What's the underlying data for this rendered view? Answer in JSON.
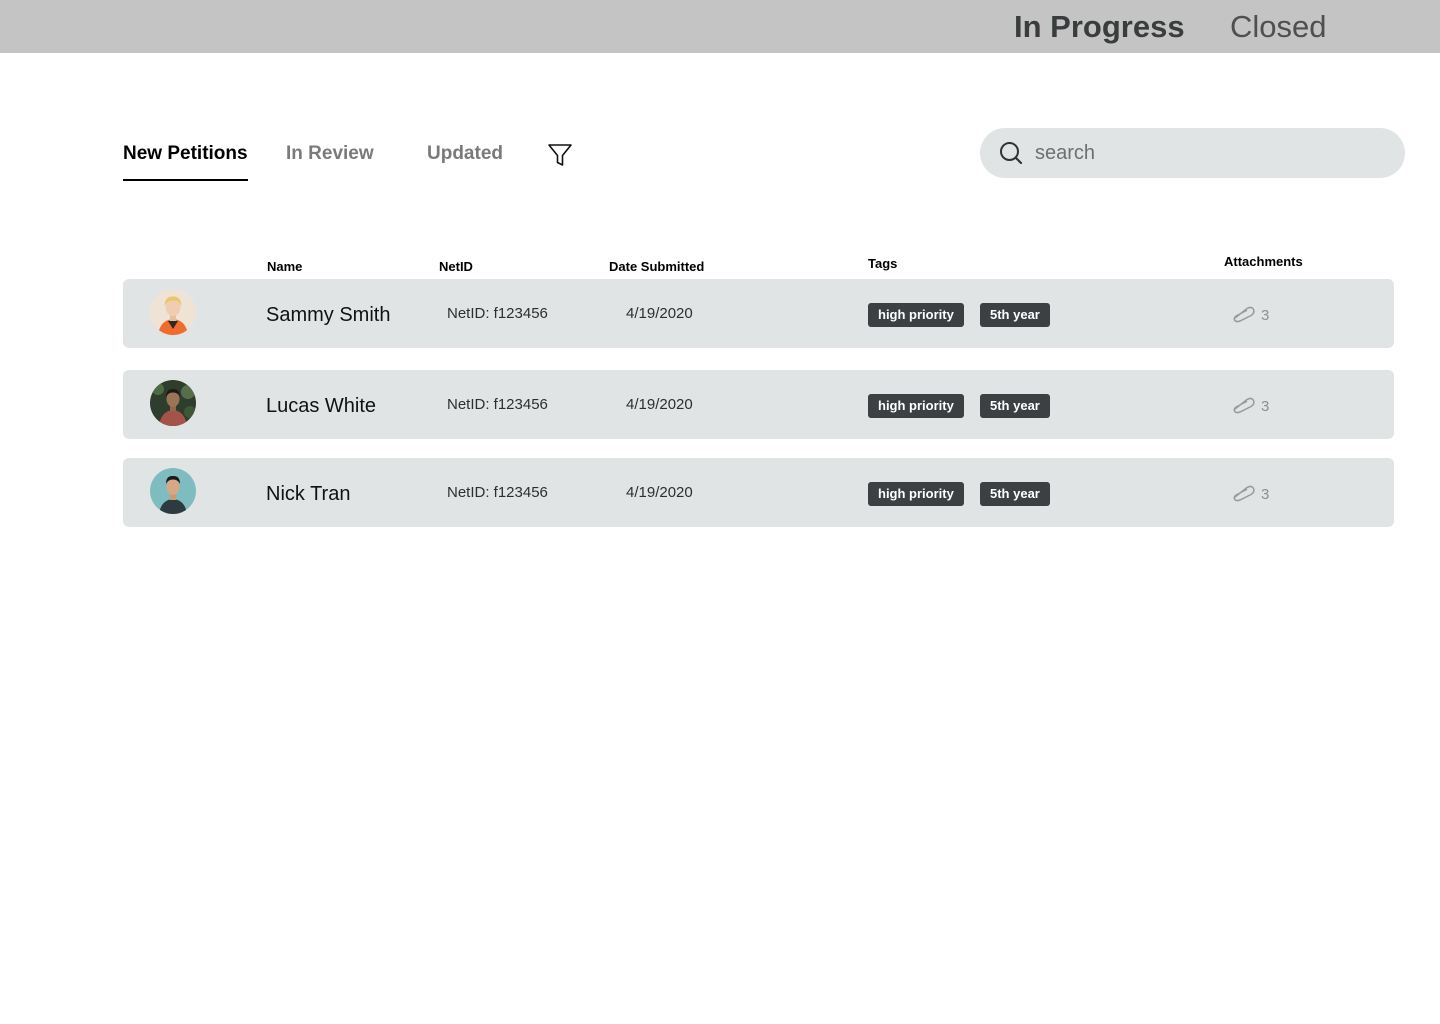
{
  "top_nav": {
    "tabs": [
      "In Progress",
      "Closed"
    ],
    "active": "In Progress"
  },
  "sub_nav": {
    "tabs": [
      "New Petitions",
      "In Review",
      "Updated"
    ],
    "active": "New Petitions"
  },
  "icons": {
    "filter": "filter-icon",
    "search": "search-icon",
    "attachment": "paperclip-icon"
  },
  "search": {
    "placeholder": "search",
    "value": ""
  },
  "table": {
    "headers": {
      "name": "Name",
      "netid": "NetID",
      "date": "Date Submitted",
      "tags": "Tags",
      "attachments": "Attachments"
    },
    "rows": [
      {
        "name": "Sammy Smith",
        "netid": "NetID: f123456",
        "date": "4/19/2020",
        "tags": [
          "high priority",
          "5th year"
        ],
        "attachments": "3"
      },
      {
        "name": "Lucas White",
        "netid": "NetID: f123456",
        "date": "4/19/2020",
        "tags": [
          "high priority",
          "5th year"
        ],
        "attachments": "3"
      },
      {
        "name": "Nick Tran",
        "netid": "NetID: f123456",
        "date": "4/19/2020",
        "tags": [
          "high priority",
          "5th year"
        ],
        "attachments": "3"
      }
    ]
  },
  "colors": {
    "topbar": "#c4c4c4",
    "row_bg": "#e1e4e5",
    "tag_bg": "#3c4042",
    "search_bg": "#e1e4e5"
  }
}
